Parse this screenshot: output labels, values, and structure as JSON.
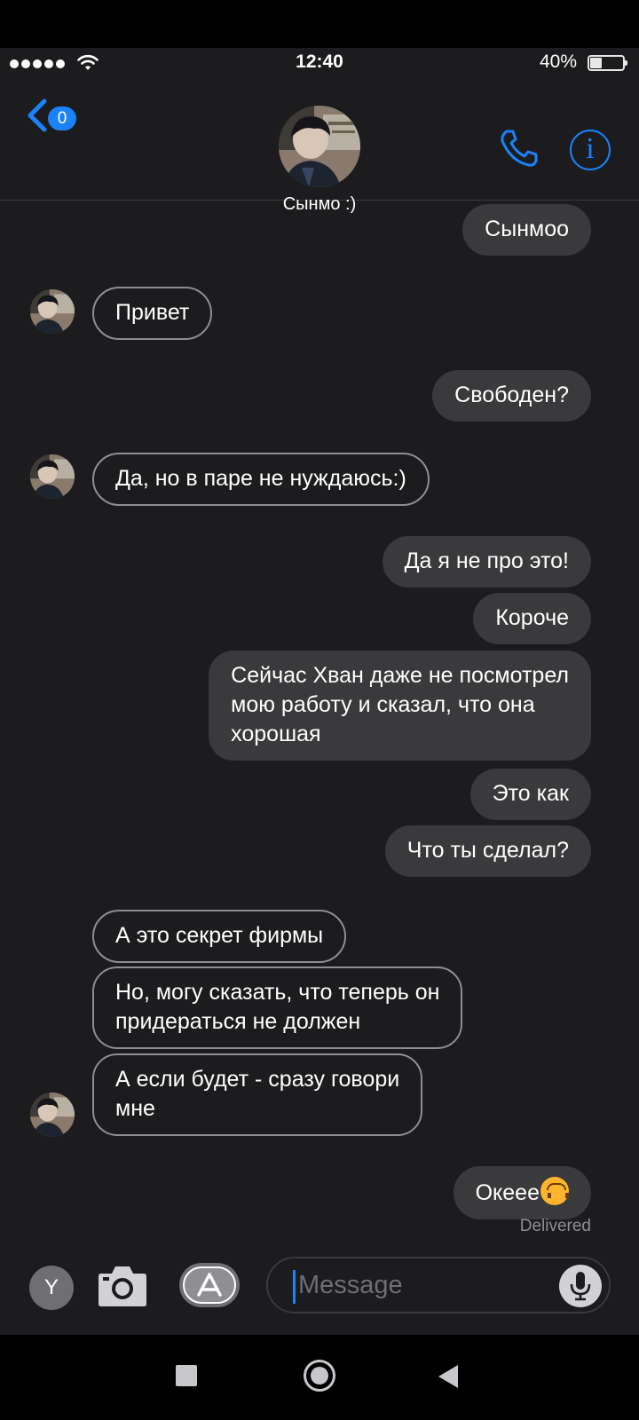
{
  "status": {
    "time": "12:40",
    "battery": "40%"
  },
  "header": {
    "back_count": "0",
    "contact_name": "Сынмо :)",
    "info_glyph": "i"
  },
  "messages": [
    {
      "dir": "sent",
      "text": "Сынмоо"
    },
    {
      "dir": "recv",
      "text": "Привет"
    },
    {
      "dir": "sent",
      "text": "Свободен?"
    },
    {
      "dir": "recv",
      "text": "Да, но в паре не нуждаюсь:)"
    },
    {
      "dir": "sent",
      "text": "Да я не про это!"
    },
    {
      "dir": "sent",
      "text": "Короче"
    },
    {
      "dir": "sent",
      "line1": "Сейчас Хван даже не посмотрел",
      "line2": "мою работу и сказал, что она",
      "line3": "хорошая"
    },
    {
      "dir": "sent",
      "text": "Это как"
    },
    {
      "dir": "sent",
      "text": "Что ты сделал?"
    },
    {
      "dir": "recv",
      "text": "А это секрет фирмы"
    },
    {
      "dir": "recv",
      "line1": "Но, могу сказать, что теперь он",
      "line2": "придераться не должен"
    },
    {
      "dir": "recv",
      "line1": "А если будет - сразу говори",
      "line2": "мне"
    },
    {
      "dir": "sent",
      "text": "Океее",
      "emoji": "upside-down-face-emoji"
    }
  ],
  "delivered": "Delivered",
  "input": {
    "profile_initial": "Y",
    "placeholder": "Message"
  },
  "colors": {
    "accent": "#1a82fb",
    "background": "#1c1c1e",
    "sent_bubble": "#3a3a3c",
    "received_border": "#8e8e93"
  },
  "icons": [
    "wifi-icon",
    "back-chevron-icon",
    "phone-icon",
    "info-icon",
    "camera-icon",
    "app-store-icon",
    "microphone-icon",
    "upside-down-face-emoji"
  ]
}
